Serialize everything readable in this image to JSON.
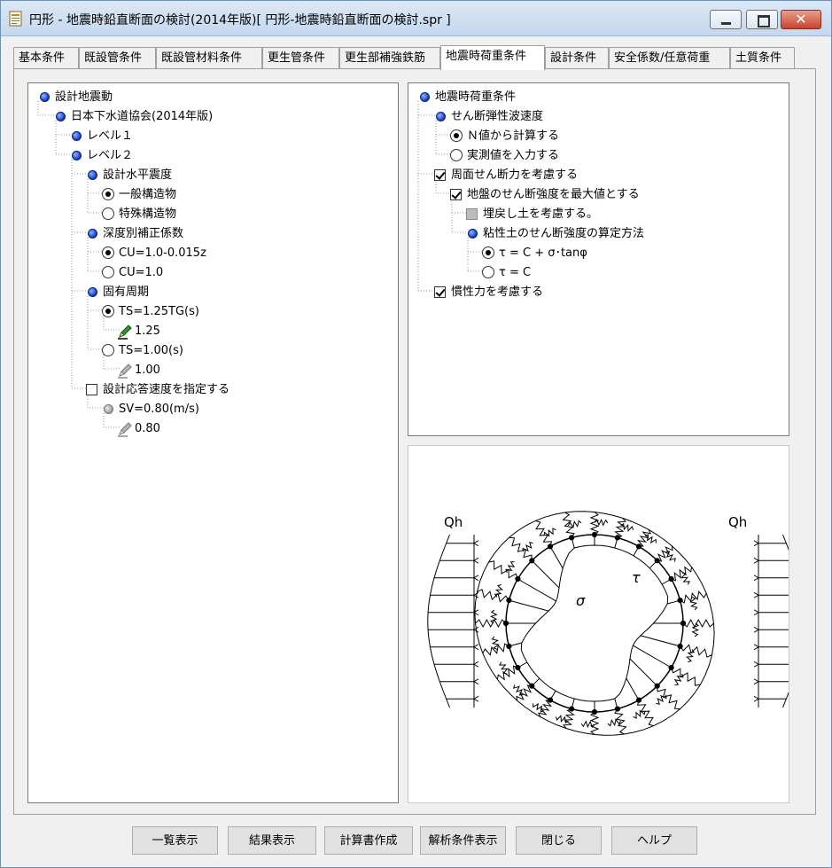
{
  "window": {
    "title": "円形 - 地震時鉛直断面の検討(2014年版)[ 円形-地震時鉛直断面の検討.spr ]",
    "close_label": "✕"
  },
  "tabs": [
    {
      "label": "基本条件"
    },
    {
      "label": "既設管条件"
    },
    {
      "label": "既設管材料条件"
    },
    {
      "label": "更生管条件"
    },
    {
      "label": "更生部補強鉄筋"
    },
    {
      "label": "地震時荷重条件"
    },
    {
      "label": "設計条件"
    },
    {
      "label": "安全係数/任意荷重"
    },
    {
      "label": "土質条件"
    }
  ],
  "left_tree": {
    "root": "設計地震動",
    "standard": "日本下水道協会(2014年版)",
    "level1": "レベル１",
    "level2": "レベル２",
    "seismic_coef": "設計水平震度",
    "general": "一般構造物",
    "special": "特殊構造物",
    "depth_coef": "深度別補正係数",
    "cu_formula": "CU=1.0-0.015z",
    "cu_const": "CU=1.0",
    "period": "固有周期",
    "ts_formula": "TS=1.25TG(s)",
    "ts_formula_value": "1.25",
    "ts_const": "TS=1.00(s)",
    "ts_const_value": "1.00",
    "sv_specify": "設計応答速度を指定する",
    "sv": "SV=0.80(m/s)",
    "sv_value": "0.80"
  },
  "right_tree": {
    "root": "地震時荷重条件",
    "shear_wave": "せん断弾性波速度",
    "from_n": "Ｎ値から計算する",
    "measured": "実測値を入力する",
    "peri_shear": "周面せん断力を考慮する",
    "max_strength": "地盤のせん断強度を最大値とする",
    "backfill": "埋戻し土を考慮する。",
    "cohesive": "粘性土のせん断強度の算定方法",
    "tau_full": "τ = C + σ･tanφ",
    "tau_c": "τ = C",
    "inertia": "慣性力を考慮する"
  },
  "figure": {
    "qh_left": "Qh",
    "qh_right": "Qh",
    "sigma": "σ",
    "tau": "τ"
  },
  "buttons": {
    "list": "一覧表示",
    "result": "結果表示",
    "report": "計算書作成",
    "analysis": "解析条件表示",
    "close": "閉じる",
    "help": "ヘルプ"
  }
}
